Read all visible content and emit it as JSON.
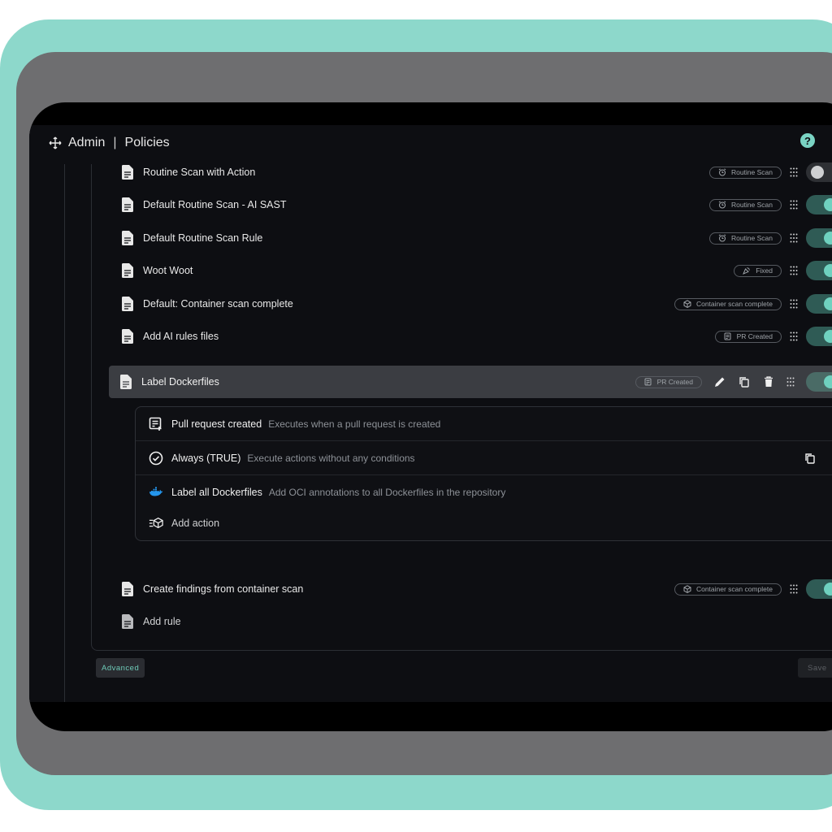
{
  "header": {
    "section": "Admin",
    "separator": "|",
    "page_title": "Policies",
    "help": "?"
  },
  "rules": [
    {
      "name": "Routine Scan with Action",
      "trigger": "Routine Scan",
      "trigger_icon": "alarm-clock-icon",
      "enabled": false
    },
    {
      "name": "Default Routine Scan - AI SAST",
      "trigger": "Routine Scan",
      "trigger_icon": "alarm-clock-icon",
      "enabled": true
    },
    {
      "name": "Default Routine Scan Rule",
      "trigger": "Routine Scan",
      "trigger_icon": "alarm-clock-icon",
      "enabled": true
    },
    {
      "name": "Woot Woot",
      "trigger": "Fixed",
      "trigger_icon": "party-popper-icon",
      "enabled": true
    },
    {
      "name": "Default: Container scan complete",
      "trigger": "Container scan complete",
      "trigger_icon": "cube-icon",
      "enabled": true
    },
    {
      "name": "Add AI rules files",
      "trigger": "PR Created",
      "trigger_icon": "pull-request-icon",
      "enabled": true
    }
  ],
  "selected_rule": {
    "name": "Label Dockerfiles",
    "trigger": "PR Created",
    "enabled": true,
    "trigger_detail": {
      "title": "Pull request created",
      "desc": "Executes when a pull request is created"
    },
    "condition": {
      "title": "Always (TRUE)",
      "desc": "Execute actions without any conditions"
    },
    "action": {
      "title": "Label all Dockerfiles",
      "desc": "Add OCI annotations to all Dockerfiles in the repository"
    },
    "add_action_label": "Add action"
  },
  "after_rules": [
    {
      "name": "Create findings from container scan",
      "trigger": "Container scan complete",
      "trigger_icon": "cube-icon",
      "enabled": true
    }
  ],
  "add_rule_label": "Add rule",
  "footer": {
    "advanced_label": "Advanced",
    "save_label": "Save"
  },
  "colors": {
    "accent": "#6fd1bf",
    "frame": "#8dd8cb",
    "background": "#0d0e12"
  }
}
